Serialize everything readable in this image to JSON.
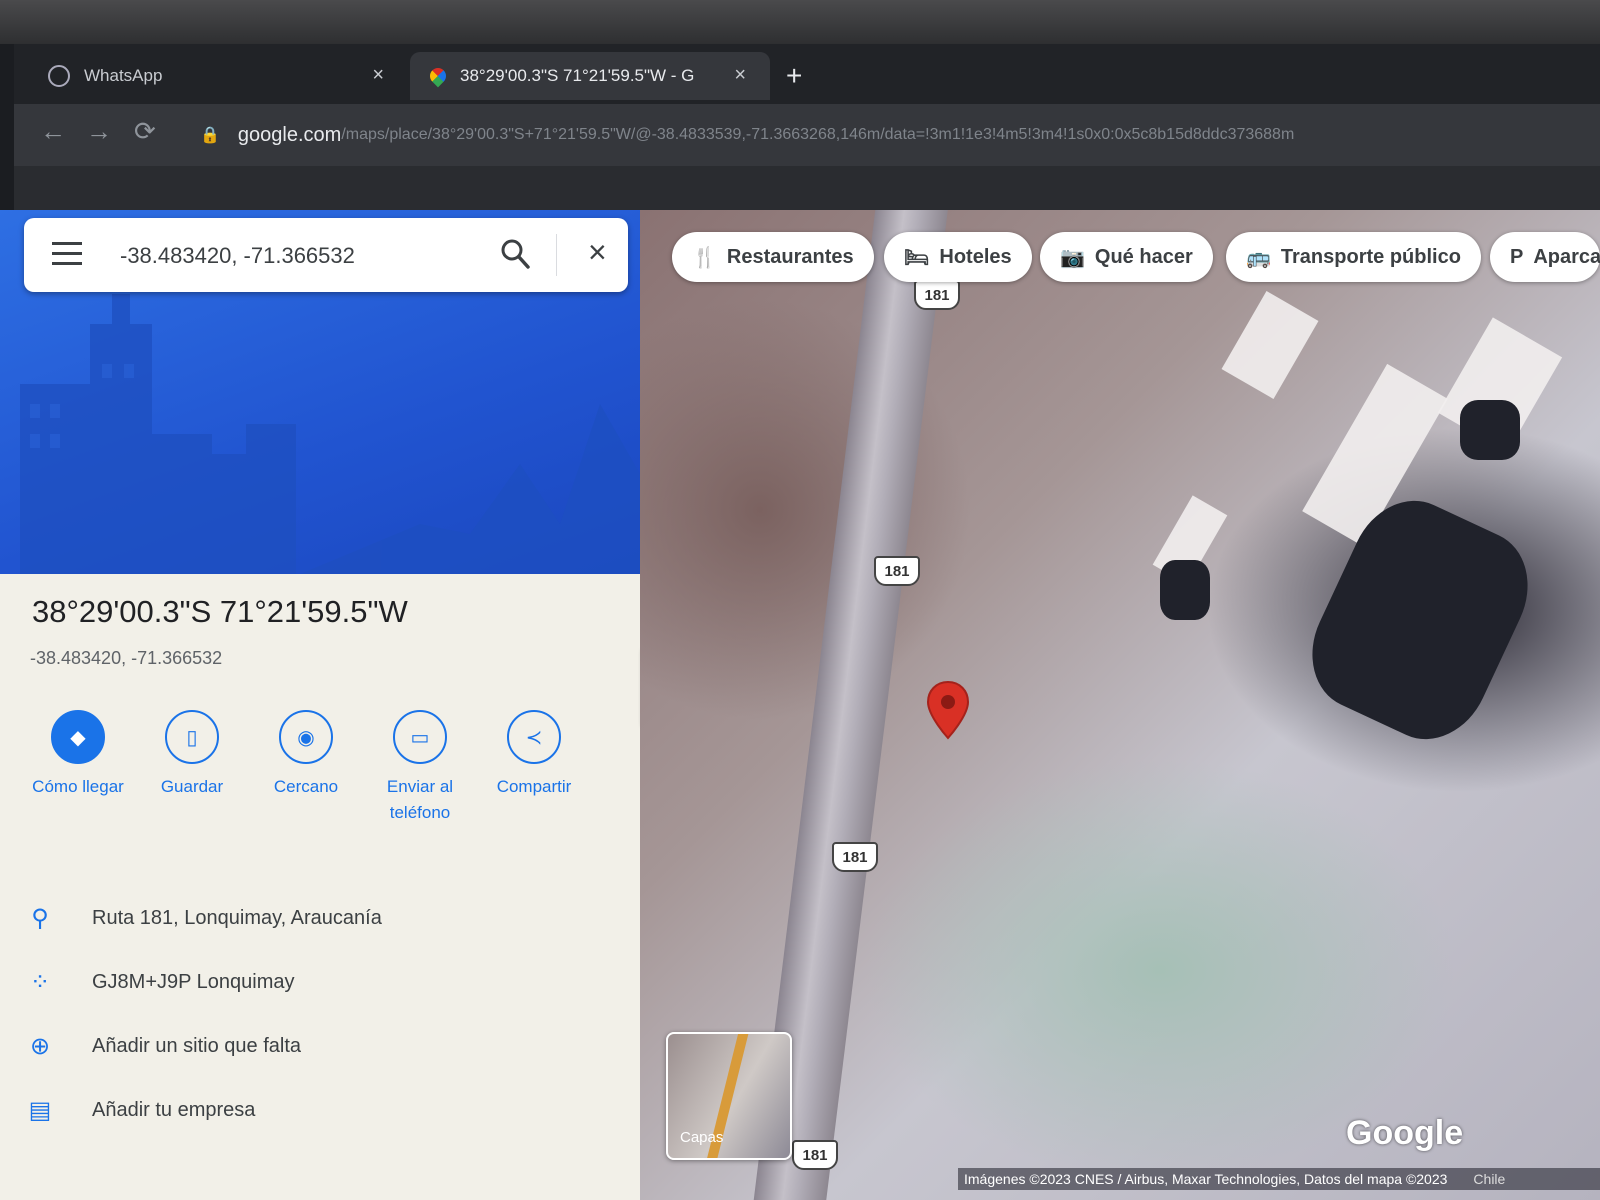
{
  "browser": {
    "tabs": [
      {
        "title": "WhatsApp",
        "icon": "whatsapp-icon",
        "active": false
      },
      {
        "title": "38°29'00.3\"S 71°21'59.5\"W - G",
        "icon": "google-maps-icon",
        "active": true
      }
    ],
    "new_tab_glyph": "+",
    "close_glyph": "×",
    "address": {
      "host": "google.com",
      "path": "/maps/place/38°29'00.3\"S+71°21'59.5\"W/@-38.4833539,-71.3663268,146m/data=!3m1!1e3!4m5!3m4!1s0x0:0x5c8b15d8ddc373688m"
    }
  },
  "search": {
    "value": "-38.483420, -71.366532",
    "clear_glyph": "×"
  },
  "place": {
    "title": "38°29'00.3\"S 71°21'59.5\"W",
    "coordinates": "-38.483420, -71.366532"
  },
  "actions": [
    {
      "label": "Cómo llegar",
      "icon": "directions-icon"
    },
    {
      "label": "Guardar",
      "icon": "bookmark-icon"
    },
    {
      "label": "Cercano",
      "icon": "nearby-icon"
    },
    {
      "label": "Enviar al teléfono",
      "icon": "send-to-phone-icon"
    },
    {
      "label": "Compartir",
      "icon": "share-icon"
    }
  ],
  "info": [
    {
      "text": "Ruta 181, Lonquimay, Araucanía",
      "icon": "location-pin-icon"
    },
    {
      "text": "GJ8M+J9P Lonquimay",
      "icon": "plus-code-icon"
    },
    {
      "text": "Añadir un sitio que falta",
      "icon": "add-place-icon"
    },
    {
      "text": "Añadir tu empresa",
      "icon": "add-business-icon"
    }
  ],
  "map": {
    "chips": [
      {
        "label": "Restaurantes",
        "icon": "restaurant-icon"
      },
      {
        "label": "Hoteles",
        "icon": "hotel-icon"
      },
      {
        "label": "Qué hacer",
        "icon": "camera-icon"
      },
      {
        "label": "Transporte público",
        "icon": "transit-icon"
      },
      {
        "label": "Aparca",
        "icon": "parking-icon"
      }
    ],
    "route_shields": [
      "181",
      "181",
      "181",
      "181"
    ],
    "layers_label": "Capas",
    "logo": "Google",
    "attribution": "Imágenes ©2023 CNES / Airbus, Maxar Technologies, Datos del mapa ©2023",
    "country": "Chile"
  },
  "colors": {
    "accent": "#1a73e8",
    "pin": "#d93025",
    "panel_bg": "#f2f0e8"
  }
}
